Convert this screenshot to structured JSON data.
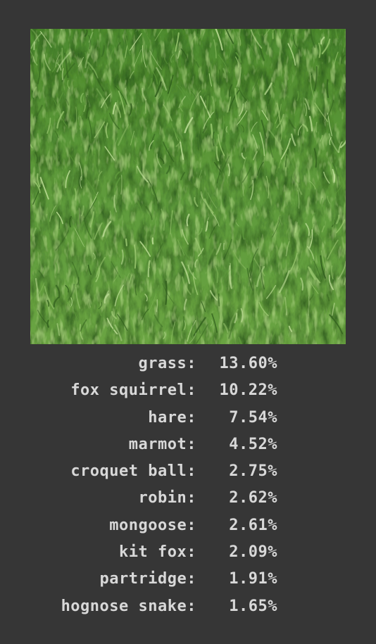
{
  "image": {
    "subject": "grass-photo",
    "colors": {
      "base": "#5f9a3c",
      "dark": "#2f5d1c",
      "light": "#9cc972",
      "highlight": "#c3e29c"
    }
  },
  "predictions": [
    {
      "label": "grass:",
      "value": "13.60%"
    },
    {
      "label": "fox squirrel:",
      "value": "10.22%"
    },
    {
      "label": "hare:",
      "value": " 7.54%"
    },
    {
      "label": "marmot:",
      "value": " 4.52%"
    },
    {
      "label": "croquet ball:",
      "value": " 2.75%"
    },
    {
      "label": "robin:",
      "value": " 2.62%"
    },
    {
      "label": "mongoose:",
      "value": " 2.61%"
    },
    {
      "label": "kit fox:",
      "value": " 2.09%"
    },
    {
      "label": "partridge:",
      "value": " 1.91%"
    },
    {
      "label": "hognose snake:",
      "value": " 1.65%"
    }
  ],
  "colors": {
    "background": "#363636",
    "text": "#d8d8d8"
  }
}
